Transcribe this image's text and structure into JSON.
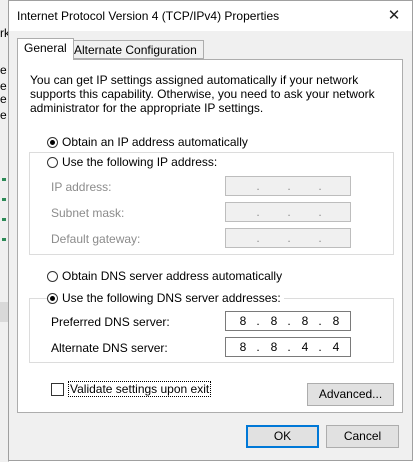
{
  "background_window": {
    "fragments": [
      "rk",
      "e",
      "e",
      "e",
      "e"
    ]
  },
  "window": {
    "title": "Internet Protocol Version 4 (TCP/IPv4) Properties",
    "close_glyph": "✕"
  },
  "tabs": [
    {
      "label": "General",
      "active": true
    },
    {
      "label": "Alternate Configuration",
      "active": false
    }
  ],
  "description": "You can get IP settings assigned automatically if your network supports this capability. Otherwise, you need to ask your network administrator for the appropriate IP settings.",
  "ip_mode": {
    "auto_label": "Obtain an IP address automatically",
    "manual_label": "Use the following IP address:",
    "selected": "auto"
  },
  "ip_fields": {
    "ip_address": {
      "label": "IP address:",
      "value": ". . .",
      "enabled": false
    },
    "subnet_mask": {
      "label": "Subnet mask:",
      "value": ". . .",
      "enabled": false
    },
    "default_gateway": {
      "label": "Default gateway:",
      "value": ". . .",
      "enabled": false
    }
  },
  "dns_mode": {
    "auto_label": "Obtain DNS server address automatically",
    "manual_label": "Use the following DNS server addresses:",
    "selected": "manual"
  },
  "dns_fields": {
    "preferred": {
      "label": "Preferred DNS server:",
      "octets": [
        "8",
        "8",
        "8",
        "8"
      ]
    },
    "alternate": {
      "label": "Alternate DNS server:",
      "octets": [
        "8",
        "8",
        "4",
        "4"
      ]
    }
  },
  "validate": {
    "label": "Validate settings upon exit",
    "checked": false
  },
  "buttons": {
    "advanced": "Advanced...",
    "ok": "OK",
    "cancel": "Cancel"
  },
  "colors": {
    "accent": "#0078d7",
    "disabled_text": "#8c8c8c"
  }
}
